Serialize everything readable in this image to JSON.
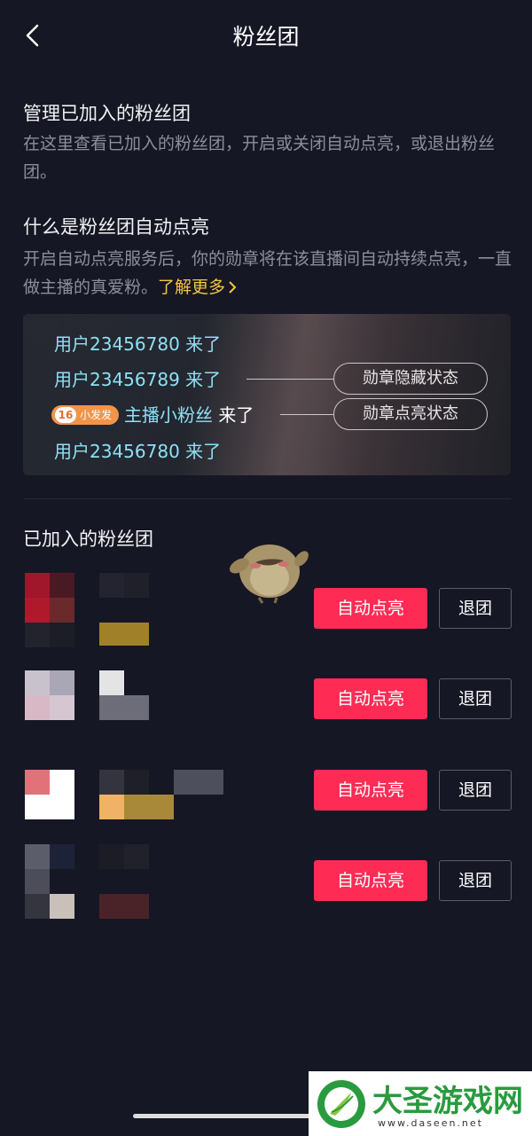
{
  "header": {
    "title": "粉丝团"
  },
  "manage": {
    "title": "管理已加入的粉丝团",
    "desc": "在这里查看已加入的粉丝团，开启或关闭自动点亮，或退出粉丝团。"
  },
  "auto_light": {
    "title": "什么是粉丝团自动点亮",
    "desc": "开启自动点亮服务后，你的勋章将在该直播间自动持续点亮，一直做主播的真爱粉。",
    "more": "了解更多"
  },
  "banner": {
    "line1": "用户23456780 来了",
    "line2": "用户23456789 来了",
    "line3_badge_level": "16",
    "line3_badge_name": "小发发",
    "line3_user": "主播小粉丝",
    "line3_suffix": " 来了",
    "line4": "用户23456780 来了",
    "hidden_state": "勋章隐藏状态",
    "lit_state": "勋章点亮状态"
  },
  "joined": {
    "title": "已加入的粉丝团",
    "rows": [
      {
        "toggle": "自动点亮",
        "quit": "退团"
      },
      {
        "toggle": "自动点亮",
        "quit": "退团"
      },
      {
        "toggle": "自动点亮",
        "quit": "退团"
      },
      {
        "toggle": "自动点亮",
        "quit": "退团"
      }
    ]
  },
  "watermark": {
    "name": "大圣游戏网",
    "url": "www.daseen.net"
  },
  "colors": {
    "accent": "#fe2c55",
    "link": "#f5c542",
    "banner_text": "#8ee0f5",
    "background": "#161724"
  }
}
